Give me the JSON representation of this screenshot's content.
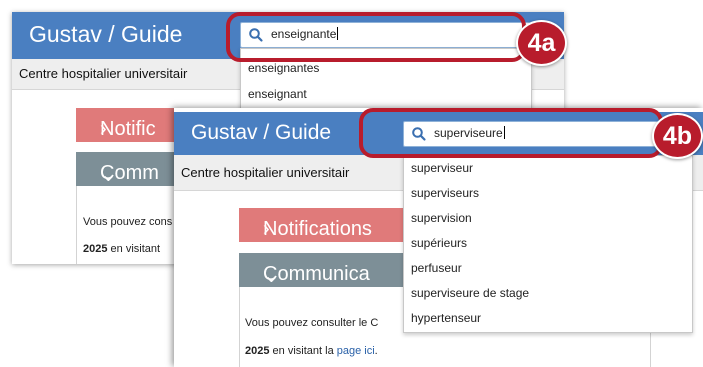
{
  "screenshot_a": {
    "app_title": "Gustav / Guide",
    "search_value": "enseignante",
    "subheader": "Centre hospitalier universitair",
    "notification_banner": "Notific",
    "communication_banner": "Comm",
    "paragraph_line1": "Vous pouvez cons",
    "paragraph_line2_bold": "2025",
    "paragraph_line2_rest": " en visitant",
    "suggestions": [
      "enseignantes",
      "enseignant"
    ]
  },
  "screenshot_b": {
    "app_title": "Gustav / Guide",
    "search_value": "superviseure",
    "subheader": "Centre hospitalier universitair",
    "notification_banner": "Notifications",
    "communication_banner": "Communica",
    "paragraph_line1": "Vous pouvez consulter le C",
    "paragraph_line2_bold": "2025",
    "paragraph_line2_rest": " en visitant la ",
    "paragraph_link": "page ici",
    "paragraph_end": ".",
    "suggestions": [
      "superviseur",
      "superviseurs",
      "supervision",
      "supérieurs",
      "perfuseur",
      "superviseure de stage",
      "hypertenseur"
    ]
  },
  "callouts": {
    "a": "4a",
    "b": "4b"
  },
  "icons": {
    "search": "search-icon",
    "expand": "chevron-right-icon",
    "collapse": "chevron-down-icon"
  },
  "colors": {
    "header": "#4a7fc1",
    "callout": "#b81c2c",
    "notification": "#e07a7a",
    "communication": "#7d8f97",
    "link": "#2a61a8"
  }
}
